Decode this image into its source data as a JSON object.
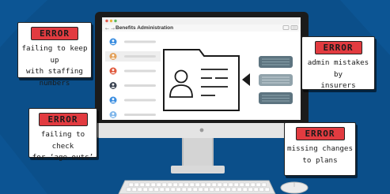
{
  "window": {
    "title": "Benefits Administration"
  },
  "sidebar": {
    "avatars": [
      {
        "color": "#3a8de0"
      },
      {
        "color": "#e3a25c"
      },
      {
        "color": "#e05a3e"
      },
      {
        "color": "#3b4452"
      },
      {
        "color": "#3a8de0"
      },
      {
        "color": "#7fb6ea"
      }
    ]
  },
  "errors": [
    {
      "tag": "ERROR",
      "lines": [
        "failing to keep up",
        "with staffing",
        "numbers"
      ]
    },
    {
      "tag": "ERROR",
      "lines": [
        "failing to check",
        "for ‘age-outs’"
      ]
    },
    {
      "tag": "ERROR",
      "lines": [
        "admin mistakes by",
        "insurers"
      ]
    },
    {
      "tag": "ERROR",
      "lines": [
        "missing changes",
        "to plans"
      ]
    }
  ],
  "colors": {
    "background": "#0b4f8a",
    "error_tag": "#e23b40",
    "monitor_frame": "#1b1b1b",
    "stand": "#c9c9c9"
  }
}
